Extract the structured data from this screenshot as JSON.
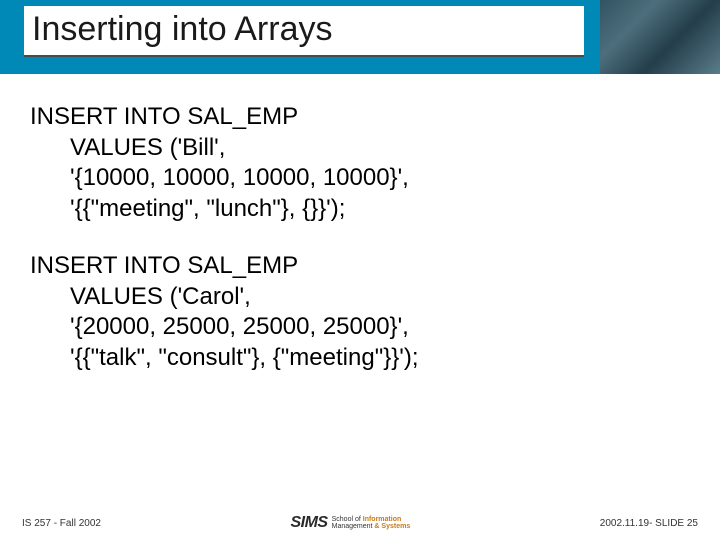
{
  "header": {
    "title": "Inserting into Arrays"
  },
  "code1": {
    "l1": "INSERT INTO SAL_EMP",
    "l2": "VALUES ('Bill',",
    "l3": "'{10000, 10000, 10000, 10000}',",
    "l4": "'{{\"meeting\", \"lunch\"}, {}}');"
  },
  "code2": {
    "l1": "INSERT INTO SAL_EMP",
    "l2": "VALUES ('Carol',",
    "l3": "'{20000, 25000, 25000, 25000}',",
    "l4": "'{{\"talk\", \"consult\"}, {\"meeting\"}}');"
  },
  "footer": {
    "left": "IS 257 - Fall 2002",
    "logo": "SIMS",
    "sub1": "School of",
    "sub2": "Information",
    "sub3": "Management",
    "sub4": "& Systems",
    "right": "2002.11.19- SLIDE 25"
  }
}
